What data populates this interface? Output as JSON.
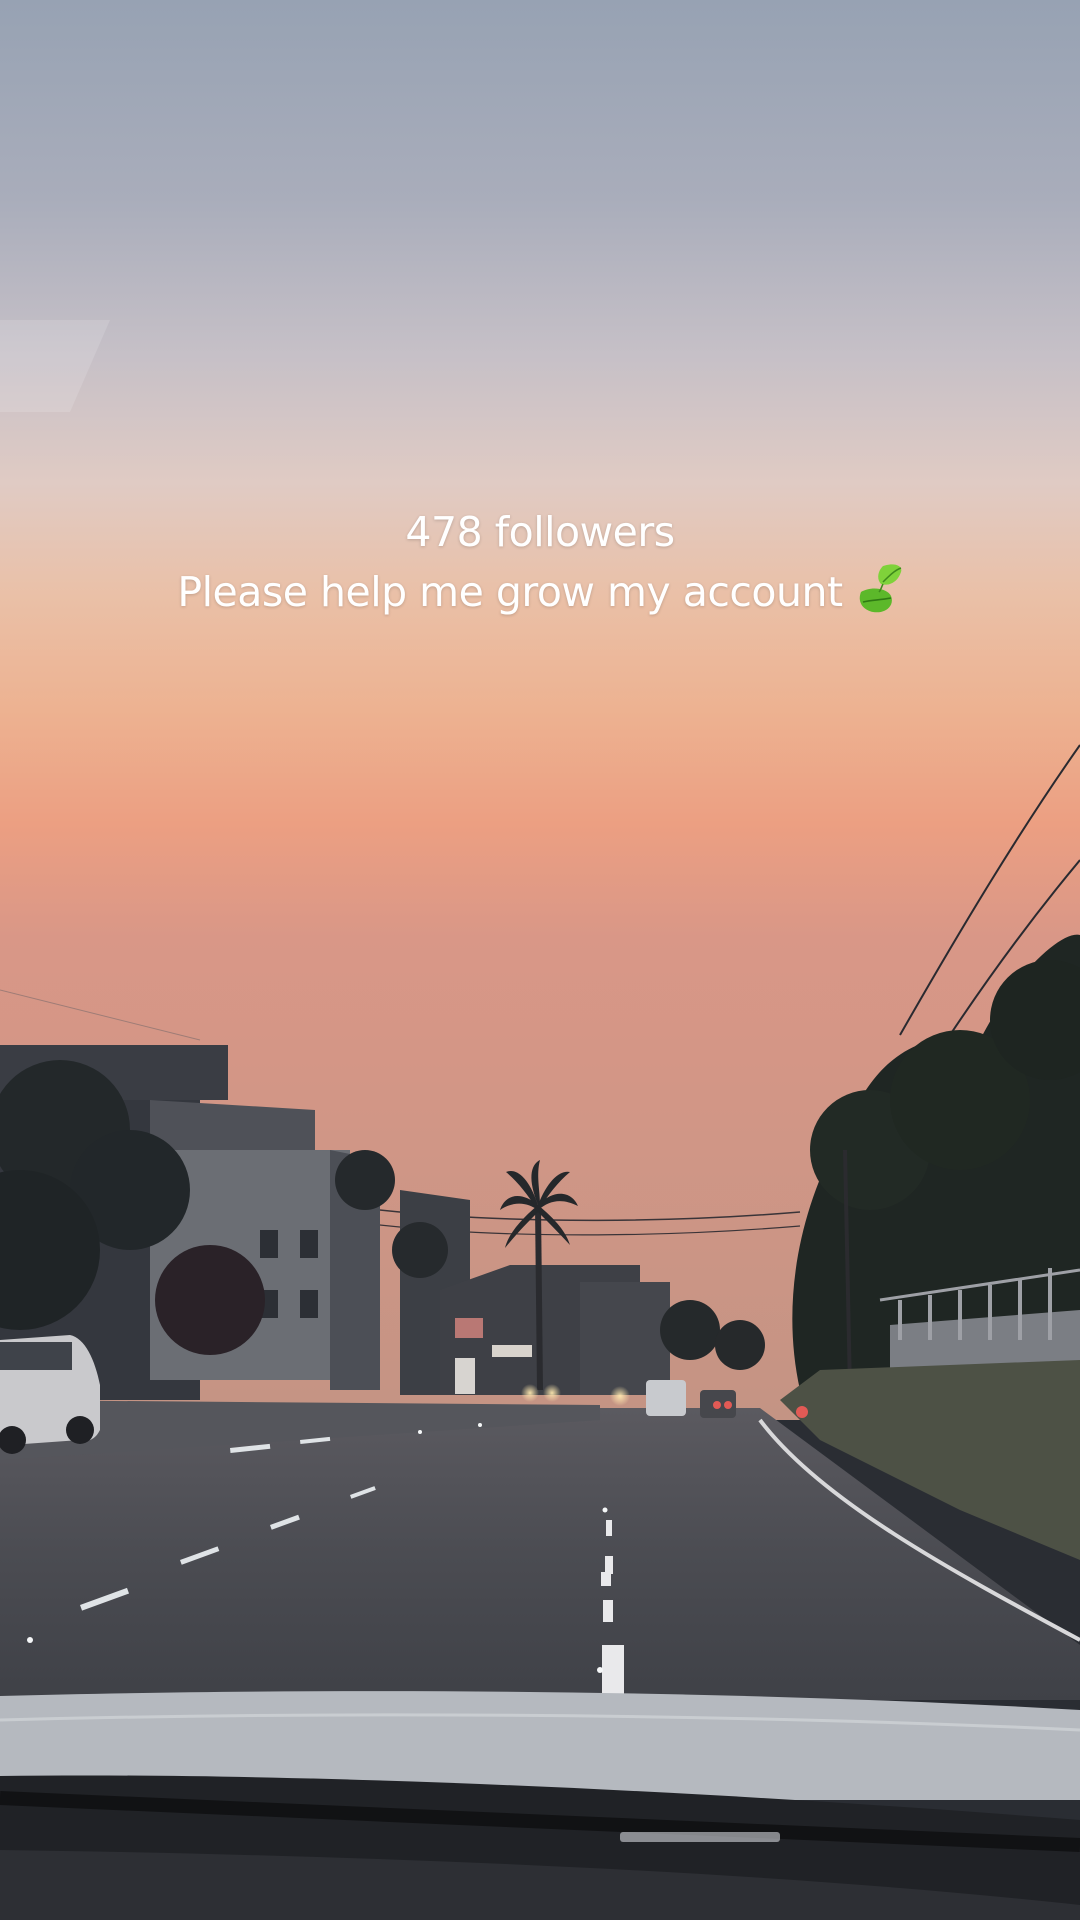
{
  "story": {
    "caption_line_1": "478 followers",
    "caption_line_2": "Please help me grow my account",
    "caption_emoji_icon": "leaf-icon"
  },
  "colors": {
    "sky_top": "#9aa4b4",
    "sky_mid": "#e6b79b",
    "sky_low": "#e79a80",
    "road": "#4a4c52",
    "text": "#ffffff",
    "leaf_green": "#5cb82a"
  }
}
